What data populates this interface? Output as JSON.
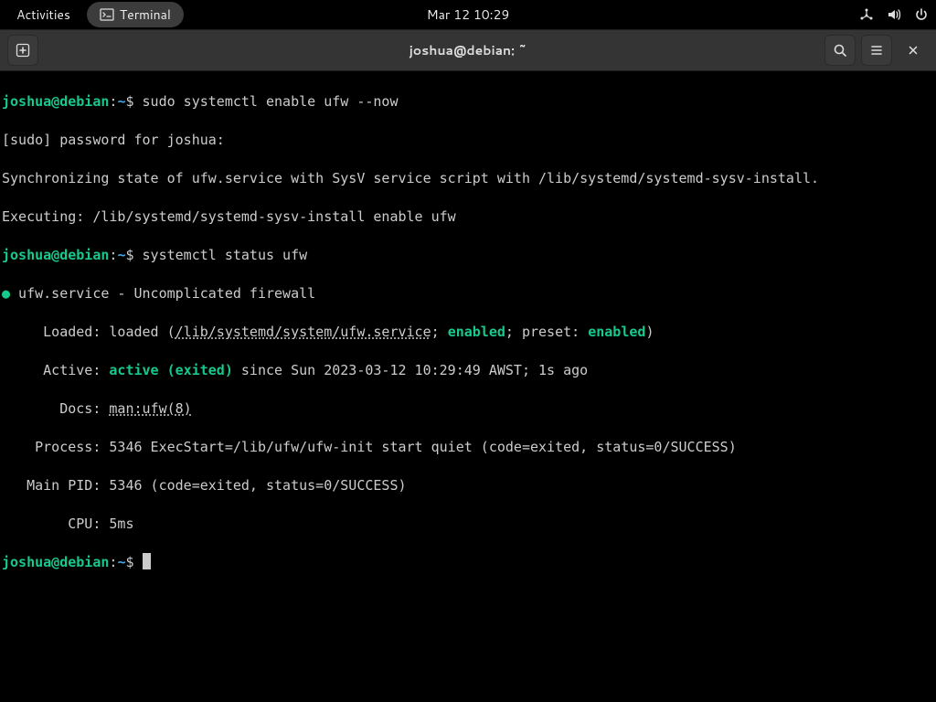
{
  "topbar": {
    "activities": "Activities",
    "app_name": "Terminal",
    "clock": "Mar 12  10:29"
  },
  "titlebar": {
    "title": "joshua@debian: ~"
  },
  "term": {
    "p": {
      "user": "joshua@debian",
      "colon": ":",
      "path": "~",
      "sym": "$"
    },
    "cmd1": " sudo systemctl enable ufw --now",
    "l1": "[sudo] password for joshua: ",
    "l2": "Synchronizing state of ufw.service with SysV service script with /lib/systemd/systemd-sysv-install.",
    "l3": "Executing: /lib/systemd/systemd-sysv-install enable ufw",
    "cmd2": " systemctl status ufw",
    "s_dot": "●",
    "s_head": " ufw.service - Uncomplicated firewall",
    "s_loaded_pre": "     Loaded: loaded (",
    "s_loaded_path": "/lib/systemd/system/ufw.service",
    "s_loaded_semi1": "; ",
    "s_enabled1": "enabled",
    "s_loaded_semi2": "; preset: ",
    "s_enabled2": "enabled",
    "s_loaded_close": ")",
    "s_active_pre": "     Active: ",
    "s_active": "active (exited)",
    "s_active_post": " since Sun 2023-03-12 10:29:49 AWST; 1s ago",
    "s_docs_pre": "       Docs: ",
    "s_docs": "man:ufw(8)",
    "s_process": "    Process: 5346 ExecStart=/lib/ufw/ufw-init start quiet (code=exited, status=0/SUCCESS)",
    "s_mainpid": "   Main PID: 5346 (code=exited, status=0/SUCCESS)",
    "s_cpu": "        CPU: 5ms"
  }
}
